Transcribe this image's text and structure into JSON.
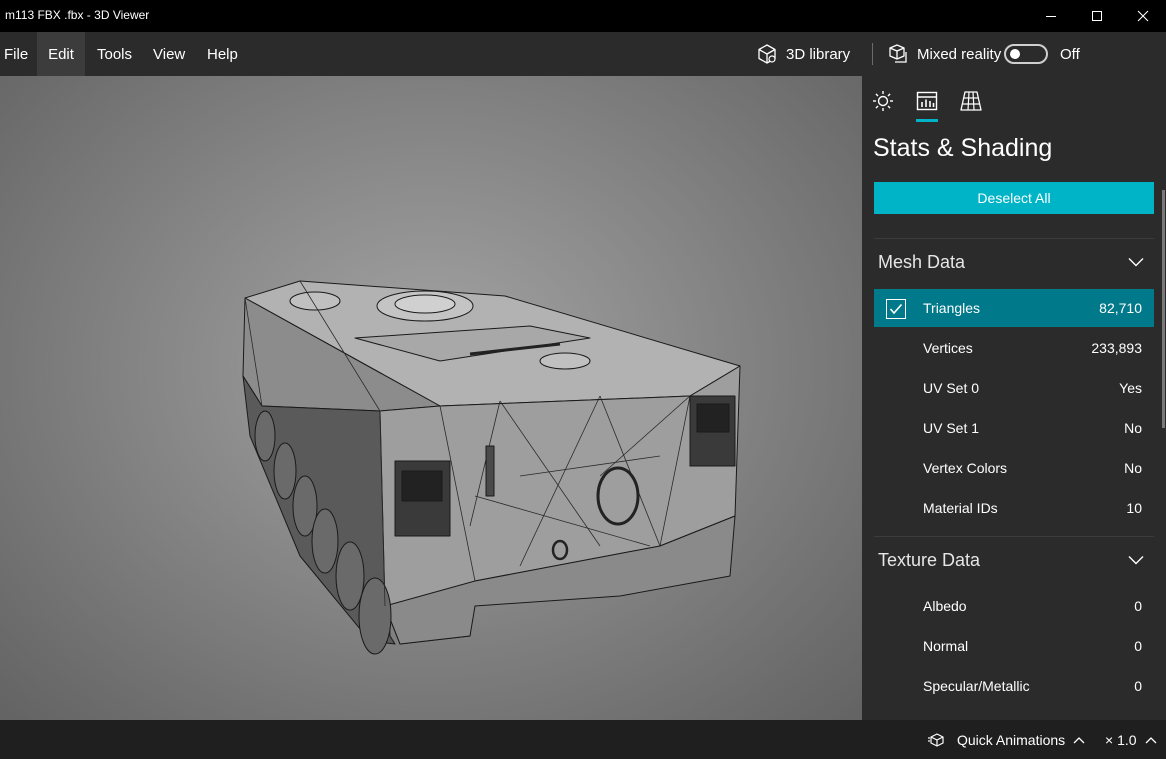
{
  "window": {
    "title": "m113 FBX .fbx - 3D Viewer"
  },
  "menu": {
    "file": "File",
    "edit": "Edit",
    "tools": "Tools",
    "view": "View",
    "help": "Help",
    "active": "Edit"
  },
  "toolbar": {
    "library_label": "3D library",
    "mixed_reality_label": "Mixed reality",
    "mixed_reality_state": "Off"
  },
  "panel": {
    "tabs": [
      {
        "name": "environment-lighting",
        "icon": "sun-icon"
      },
      {
        "name": "stats-shading",
        "icon": "stats-icon",
        "selected": true
      },
      {
        "name": "grid-view",
        "icon": "grid-icon"
      }
    ],
    "title": "Stats & Shading",
    "deselect_label": "Deselect All",
    "mesh_section": {
      "title": "Mesh Data",
      "rows": [
        {
          "label": "Triangles",
          "value": "82,710",
          "checked": true
        },
        {
          "label": "Vertices",
          "value": "233,893"
        },
        {
          "label": "UV Set 0",
          "value": "Yes"
        },
        {
          "label": "UV Set 1",
          "value": "No"
        },
        {
          "label": "Vertex Colors",
          "value": "No"
        },
        {
          "label": "Material IDs",
          "value": "10"
        }
      ]
    },
    "texture_section": {
      "title": "Texture Data",
      "rows": [
        {
          "label": "Albedo",
          "value": "0"
        },
        {
          "label": "Normal",
          "value": "0"
        },
        {
          "label": "Specular/Metallic",
          "value": "0"
        }
      ]
    }
  },
  "statusbar": {
    "quick_animations": "Quick Animations",
    "speed": "× 1.0"
  },
  "colors": {
    "accent": "#00b4c8",
    "selected_row": "#00798a",
    "panel_bg": "#2b2b2b",
    "menu_bg": "#2b2b2b"
  }
}
